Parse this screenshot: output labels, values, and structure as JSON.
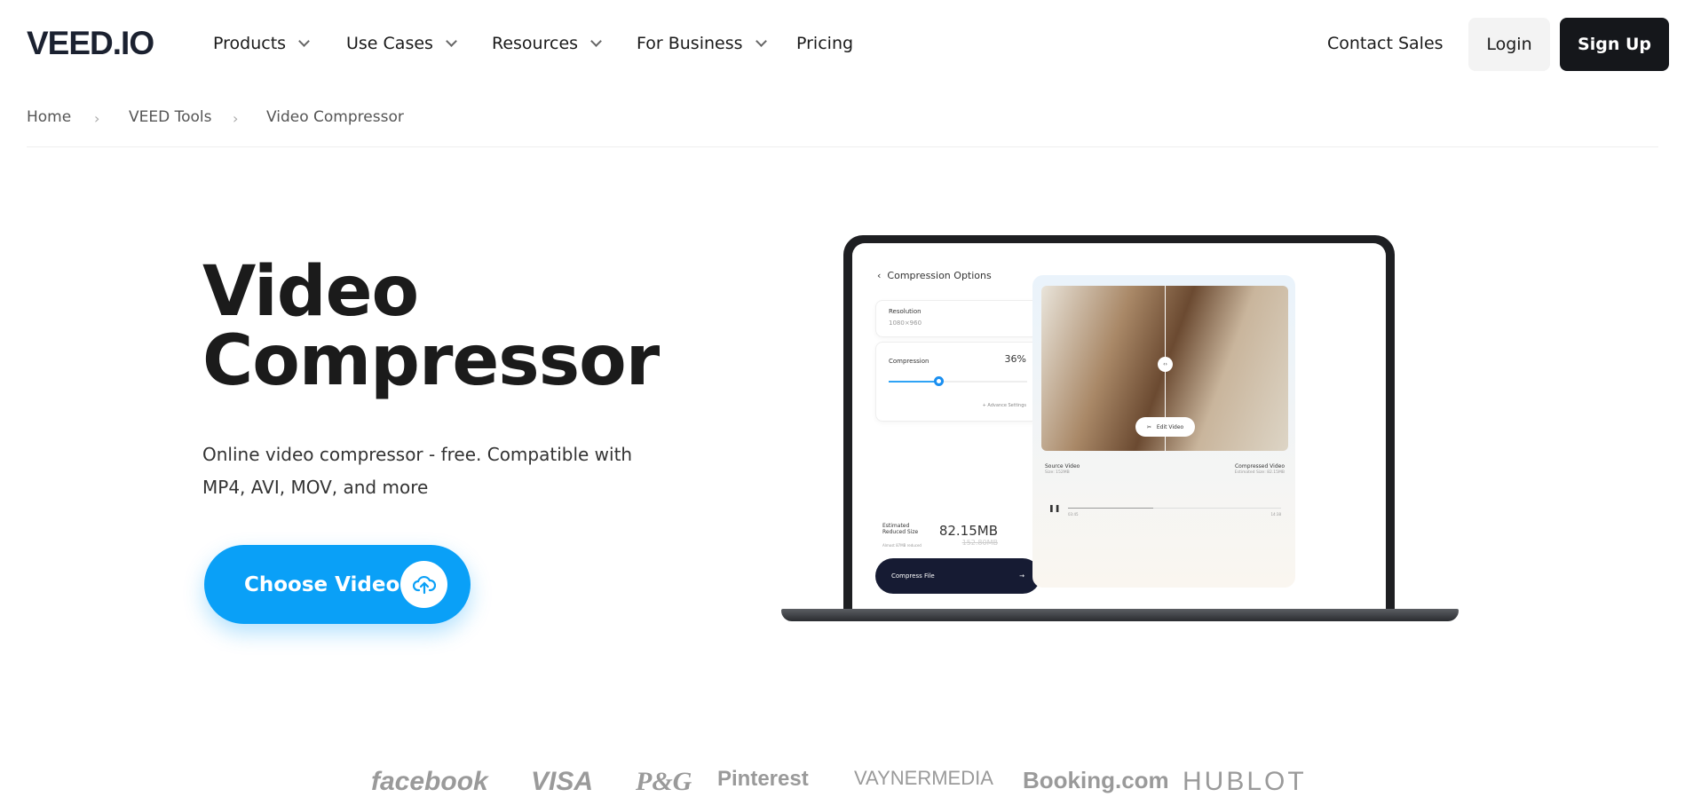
{
  "header": {
    "logo": "VEED.IO",
    "nav": [
      {
        "label": "Products"
      },
      {
        "label": "Use Cases"
      },
      {
        "label": "Resources"
      },
      {
        "label": "For Business"
      },
      {
        "label": "Pricing"
      }
    ],
    "contact_sales": "Contact Sales",
    "login": "Login",
    "signup": "Sign Up"
  },
  "breadcrumb": [
    "Home",
    "VEED Tools",
    "Video Compressor"
  ],
  "hero": {
    "title_line1": "Video",
    "title_line2": "Compressor",
    "subtitle": "Online video compressor - free. Compatible with MP4, AVI, MOV, and more",
    "cta": "Choose Video",
    "cta_icon": "upload-cloud-icon",
    "accent": "#0aa0f7"
  },
  "mockup": {
    "panel_title": "Compression Options",
    "resolution_label": "Resolution",
    "resolution_value": "1080×960",
    "compression_label": "Compression",
    "compression_value": "36%",
    "compression_level": 0.36,
    "advance": "+ Advance Settings",
    "estimated_label": "Estimated Reduced Size",
    "reduced_note": "Almost 87MB reduced",
    "new_size": "82.15MB",
    "old_size": "152.80MB",
    "compress_button": "Compress File",
    "edit_video": "Edit Video",
    "source_label": "Source Video",
    "source_size": "Size: 152MB",
    "compressed_label": "Compressed Video",
    "compressed_size": "Estimated Size: 82.15MB",
    "time_current": "03:45",
    "time_total": "14:38"
  },
  "brands": [
    "facebook",
    "VISA",
    "P&G",
    "Pinterest",
    "VAYNERMEDIA",
    "Booking.com",
    "HUBLOT"
  ]
}
